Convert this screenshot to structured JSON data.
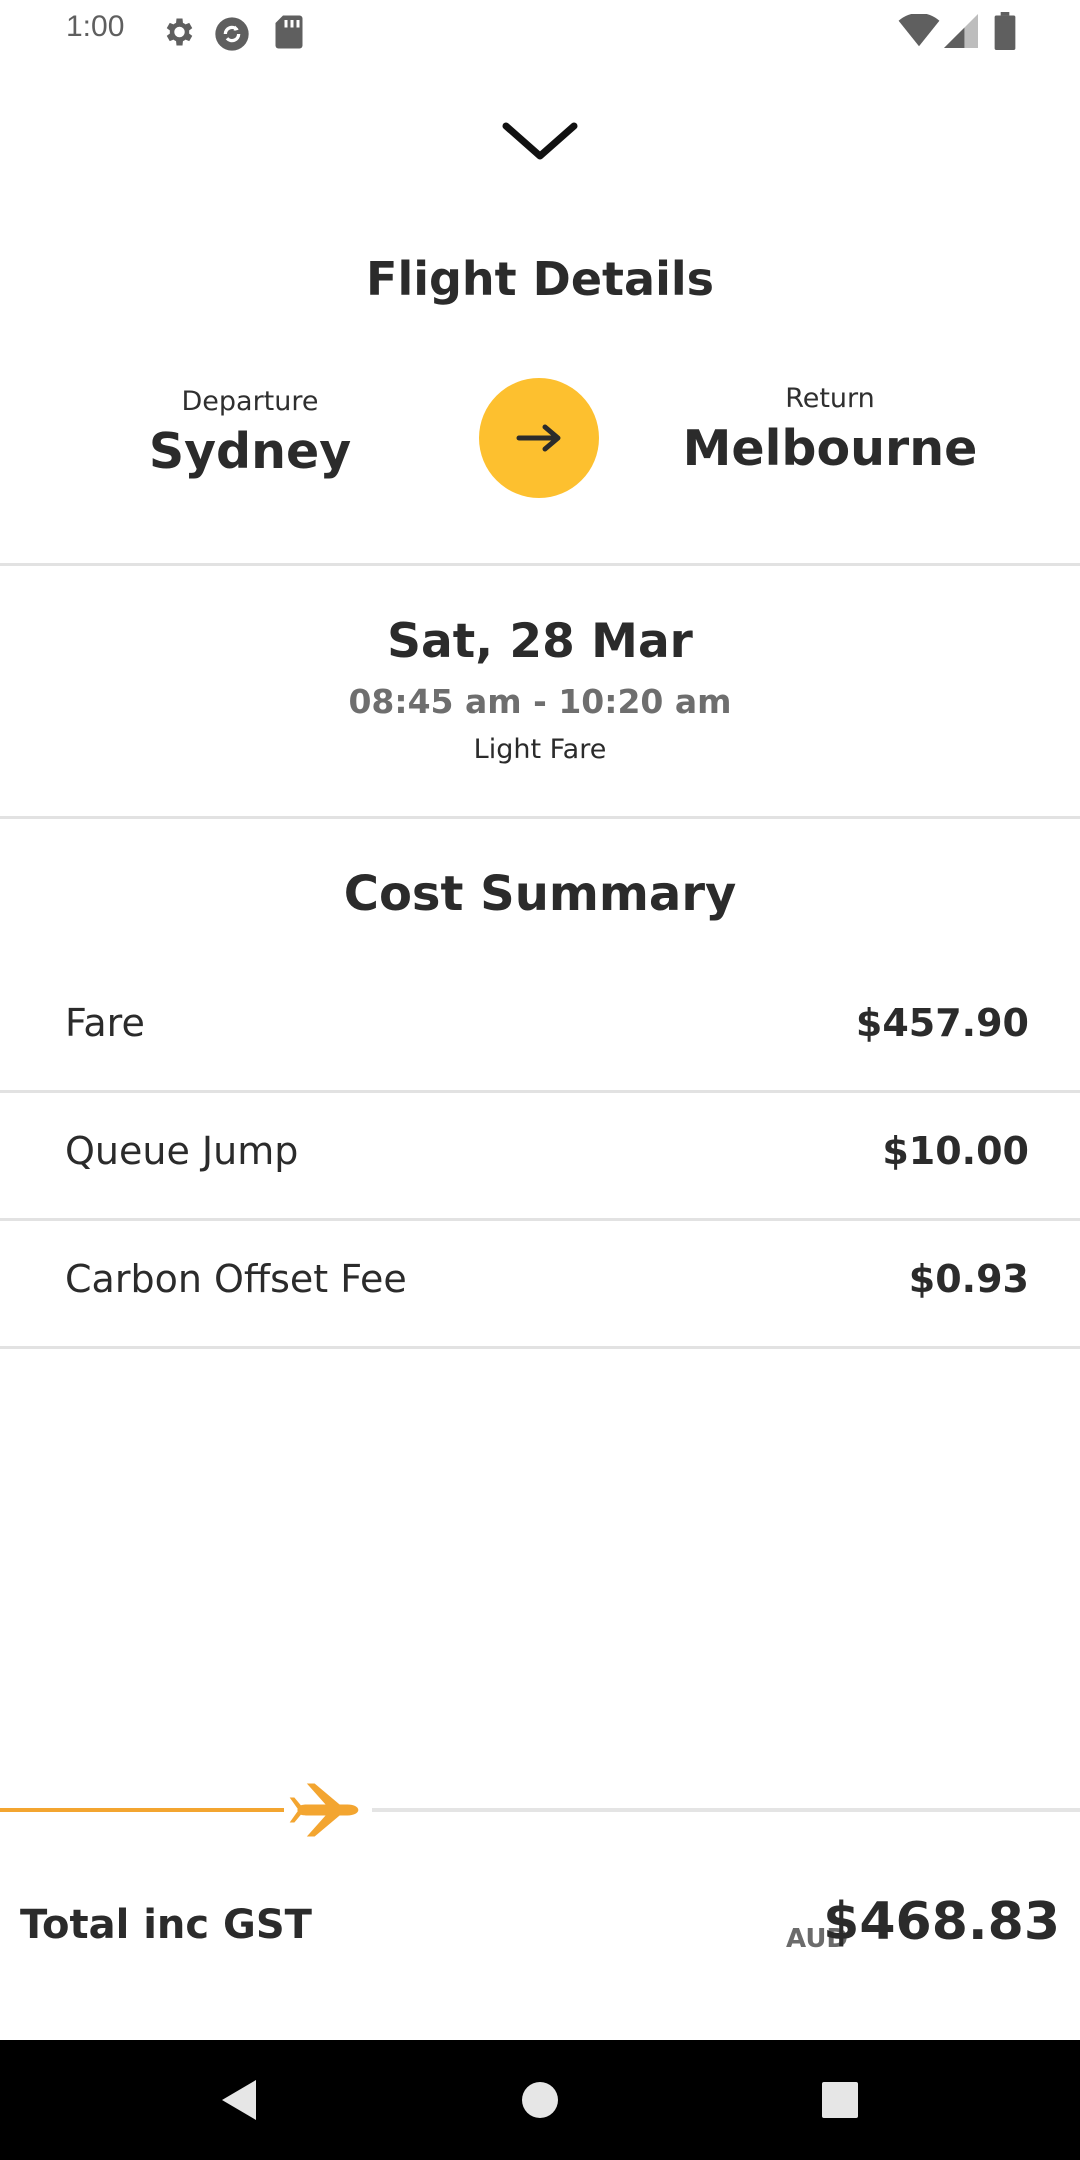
{
  "status_bar": {
    "time": "1:00",
    "left_icons": [
      "gear-icon",
      "sync-icon",
      "sd-card-icon"
    ],
    "right_icons": [
      "wifi-icon",
      "signal-icon",
      "battery-icon"
    ]
  },
  "flight_details": {
    "title": "Flight Details",
    "departure_label": "Departure",
    "departure_city": "Sydney",
    "return_label": "Return",
    "return_city": "Melbourne",
    "direction_icon": "arrow-right-icon",
    "date": "Sat, 28 Mar",
    "time_range": "08:45 am - 10:20 am",
    "fare_type": "Light Fare"
  },
  "cost_summary": {
    "title": "Cost Summary",
    "items": [
      {
        "label": "Fare",
        "value": "$457.90"
      },
      {
        "label": "Queue Jump",
        "value": "$10.00"
      },
      {
        "label": "Carbon Offset Fee",
        "value": "$0.93"
      }
    ]
  },
  "booking_progress": {
    "fraction": 0.3,
    "icon": "airplane-icon"
  },
  "total": {
    "label": "Total inc GST",
    "currency": "AUD",
    "amount": "$468.83"
  },
  "colors": {
    "accent": "#fdc02f",
    "progress": "#f3a530",
    "text": "#2b2b2b",
    "divider": "#e2e2e2"
  }
}
